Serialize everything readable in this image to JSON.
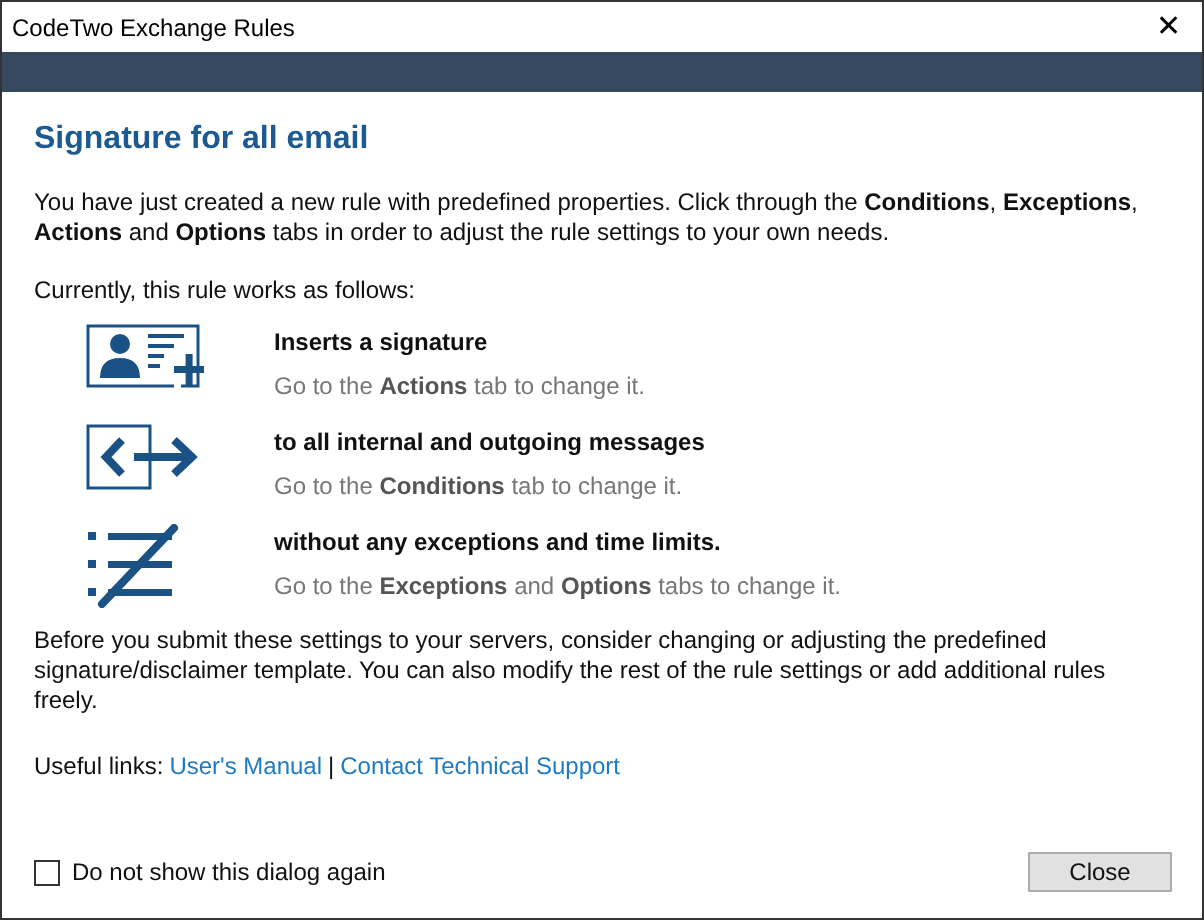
{
  "window": {
    "title": "CodeTwo Exchange Rules",
    "close": "✕"
  },
  "heading": "Signature for all email",
  "intro": "You have just created a new rule with predefined properties. Click through the **Conditions**, **Exceptions**, **Actions** and **Options** tabs in order to adjust the rule settings to your own needs.",
  "summary_label": "Currently, this rule works as follows:",
  "rules": [
    {
      "kind": "signature",
      "title": "Inserts a signature",
      "hint": "Go to the **Actions** tab to change it."
    },
    {
      "kind": "messages",
      "title": "to all internal and outgoing messages",
      "hint": "Go to the **Conditions** tab to change it."
    },
    {
      "kind": "exceptions",
      "title": "without any exceptions and time limits.",
      "hint": "Go to the **Exceptions** and **Options** tabs to change it."
    }
  ],
  "note": "Before you submit these settings to your servers, consider changing or adjusting the predefined signature/disclaimer template. You can also modify the rest of the rule settings or add additional rules freely.",
  "links": {
    "label": "Useful links:",
    "items": [
      "User's Manual",
      "Contact Technical Support"
    ],
    "separator": "|"
  },
  "checkbox": {
    "label": "Do not show this dialog again",
    "checked": false
  },
  "button": "Close"
}
